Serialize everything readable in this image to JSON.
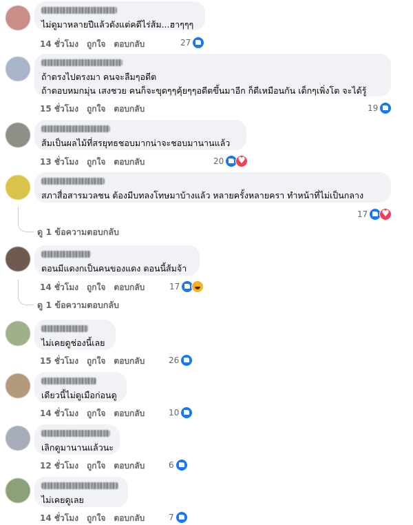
{
  "comments": [
    {
      "text": "ไม่ดูมาหลายปีแล้วดังแต่คดีไร่ส้ม...ฮาๆๆๆ",
      "time": "14 ชั่วโมง",
      "count": "27",
      "reactions": [
        "like"
      ],
      "avatar": "#c98f87"
    },
    {
      "text": "ถ้าตรงไปตรงมา คนจะลืมๆอดีต",
      "text2": "ถ้าตอบหมกมุ่น เสงชวย คนก็จะขุดๆๆคุ้ยๆๆอดีตขึ้นมาอีก ก็ดีเหมือนกัน เด็กๆเพิ่งโต จะได้รู้",
      "time": "15 ชั่วโมง",
      "count": "19",
      "reactions": [
        "like"
      ],
      "avatar": "#a9b6c9"
    },
    {
      "text": "ส้มเป็นผลไม้ที่สรยุทธชอบมากน่าจะชอบมานานแล้ว",
      "time": "13 ชั่วโมง",
      "count": "20",
      "reactions": [
        "like",
        "heart"
      ],
      "avatar": "#8e8f86"
    },
    {
      "text": "สภาสื่อสารมวลชน ต้องมีบทลงโทษมาบ้างแล้ว หลายครั้งหลายครา ทำหน้าที่ไม่เป็นกลาง",
      "time": "",
      "count": "17",
      "reactions": [
        "like",
        "heart"
      ],
      "avatar": "#d9c34a",
      "replies": "ดู 1 ข้อความตอบกลับ"
    },
    {
      "text": "ตอนมีแดงกเป็นคนของแดง ตอนนี้ส้มจ้า",
      "time": "14 ชั่วโมง",
      "count": "17",
      "reactions": [
        "like",
        "haha"
      ],
      "avatar": "#6e5a4e",
      "replies": "ดู 1 ข้อความตอบกลับ"
    },
    {
      "text": "ไม่เคยดูช่องนี้เลย",
      "time": "15 ชั่วโมง",
      "count": "26",
      "reactions": [
        "like"
      ],
      "avatar": "#9fb08a"
    },
    {
      "text": "เดียวนี้ไม่ดูเมือก่อนดู",
      "time": "14 ชั่วโมง",
      "count": "10",
      "reactions": [
        "like"
      ],
      "avatar": "#b49a7c"
    },
    {
      "text": "เลิกดูมานานแล้วนะ",
      "time": "12 ชั่วโมง",
      "count": "6",
      "reactions": [
        "like"
      ],
      "avatar": "#a7aeb9"
    },
    {
      "text": "ไม่เคยดูเลย",
      "time": "14 ชั่วโมง",
      "count": "7",
      "reactions": [
        "like"
      ],
      "avatar": "#8aa17a"
    }
  ],
  "labels": {
    "like": "ถูกใจ",
    "reply": "ตอบกลับ"
  }
}
